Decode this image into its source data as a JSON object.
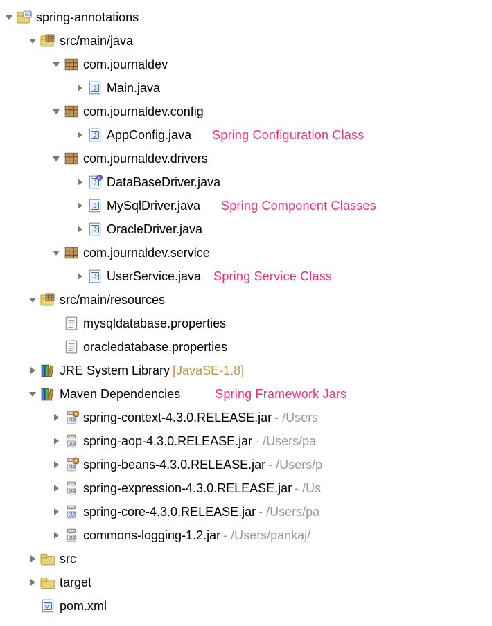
{
  "project": {
    "name": "spring-annotations",
    "src_main_java": {
      "label": "src/main/java",
      "pkg_journaldev": {
        "label": "com.journaldev",
        "main_java": "Main.java"
      },
      "pkg_config": {
        "label": "com.journaldev.config",
        "appconfig": "AppConfig.java",
        "annotation": "Spring Configuration Class"
      },
      "pkg_drivers": {
        "label": "com.journaldev.drivers",
        "db_driver": "DataBaseDriver.java",
        "mysql_driver": "MySqlDriver.java",
        "oracle_driver": "OracleDriver.java",
        "annotation": "Spring Component Classes"
      },
      "pkg_service": {
        "label": "com.journaldev.service",
        "user_service": "UserService.java",
        "annotation": "Spring Service Class"
      }
    },
    "src_main_resources": {
      "label": "src/main/resources",
      "mysql_props": "mysqldatabase.properties",
      "oracle_props": "oracledatabase.properties"
    },
    "jre": {
      "label": "JRE System Library",
      "suffix": "[JavaSE-1.8]"
    },
    "maven": {
      "label": "Maven Dependencies",
      "annotation": "Spring Framework Jars",
      "jars": [
        {
          "name": "spring-context-4.3.0.RELEASE.jar",
          "path": " - /Users"
        },
        {
          "name": "spring-aop-4.3.0.RELEASE.jar",
          "path": " - /Users/pa"
        },
        {
          "name": "spring-beans-4.3.0.RELEASE.jar",
          "path": " - /Users/p"
        },
        {
          "name": "spring-expression-4.3.0.RELEASE.jar",
          "path": " - /Us"
        },
        {
          "name": "spring-core-4.3.0.RELEASE.jar",
          "path": " - /Users/pa"
        },
        {
          "name": "commons-logging-1.2.jar",
          "path": " - /Users/pankaj/"
        }
      ]
    },
    "src_folder": "src",
    "target_folder": "target",
    "pom": "pom.xml"
  }
}
